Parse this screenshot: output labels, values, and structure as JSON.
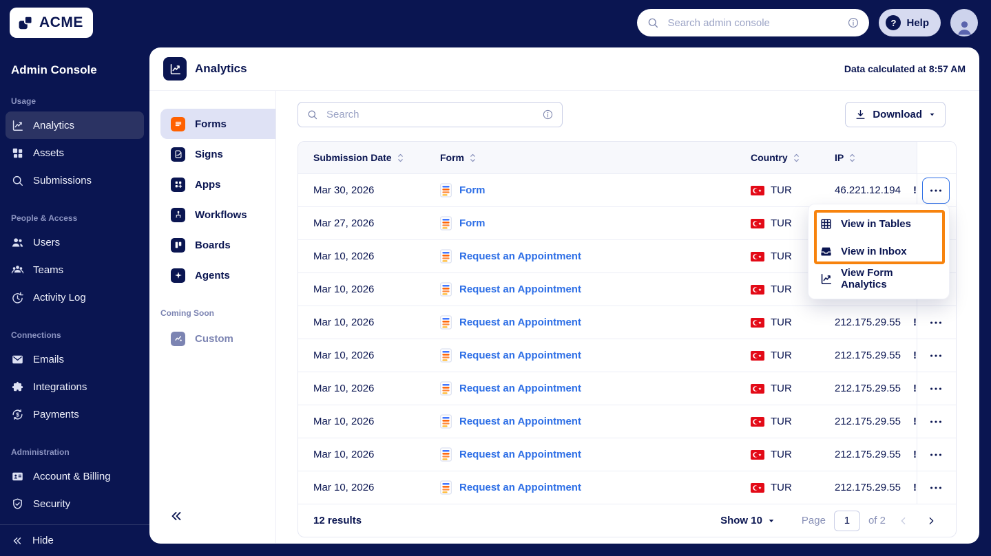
{
  "topbar": {
    "logo_text": "ACME",
    "search_placeholder": "Search admin console",
    "help_label": "Help",
    "help_glyph": "?"
  },
  "sidebar": {
    "title": "Admin Console",
    "sections": [
      {
        "label": "Usage",
        "items": [
          {
            "label": "Analytics",
            "icon": "analytics",
            "active": true
          },
          {
            "label": "Assets",
            "icon": "assets"
          },
          {
            "label": "Submissions",
            "icon": "search"
          }
        ]
      },
      {
        "label": "People & Access",
        "items": [
          {
            "label": "Users",
            "icon": "users"
          },
          {
            "label": "Teams",
            "icon": "teams"
          },
          {
            "label": "Activity Log",
            "icon": "activity"
          }
        ]
      },
      {
        "label": "Connections",
        "items": [
          {
            "label": "Emails",
            "icon": "mail"
          },
          {
            "label": "Integrations",
            "icon": "puzzle"
          },
          {
            "label": "Payments",
            "icon": "payments"
          }
        ]
      },
      {
        "label": "Administration",
        "items": [
          {
            "label": "Account & Billing",
            "icon": "card"
          },
          {
            "label": "Security",
            "icon": "shield"
          }
        ]
      }
    ],
    "hide_label": "Hide"
  },
  "card": {
    "title": "Analytics",
    "calculated": "Data calculated at 8:57 AM"
  },
  "subnav": {
    "items": [
      {
        "label": "Forms",
        "icon": "forms",
        "tile": "orange",
        "active": true
      },
      {
        "label": "Signs",
        "icon": "signs",
        "tile": "navy"
      },
      {
        "label": "Apps",
        "icon": "apps",
        "tile": "navy"
      },
      {
        "label": "Workflows",
        "icon": "workflows",
        "tile": "navy"
      },
      {
        "label": "Boards",
        "icon": "boards",
        "tile": "navy"
      },
      {
        "label": "Agents",
        "icon": "agents",
        "tile": "navy"
      }
    ],
    "coming_soon_label": "Coming Soon",
    "coming_soon_items": [
      {
        "label": "Custom",
        "icon": "custom",
        "tile": "slate"
      }
    ]
  },
  "toolbar": {
    "search_placeholder": "Search",
    "download_label": "Download"
  },
  "table": {
    "columns": [
      "Submission Date",
      "Form",
      "Country",
      "IP"
    ],
    "rows": [
      {
        "date": "Mar 30, 2026",
        "form": "Form",
        "country": "TUR",
        "ip": "46.221.12.194",
        "clip": "!",
        "menu_open": true
      },
      {
        "date": "Mar 27, 2026",
        "form": "Form",
        "country": "TUR",
        "ip": "",
        "clip": ""
      },
      {
        "date": "Mar 10, 2026",
        "form": "Request an Appointment",
        "country": "TUR",
        "ip": "",
        "clip": ""
      },
      {
        "date": "Mar 10, 2026",
        "form": "Request an Appointment",
        "country": "TUR",
        "ip": "",
        "clip": ""
      },
      {
        "date": "Mar 10, 2026",
        "form": "Request an Appointment",
        "country": "TUR",
        "ip": "212.175.29.55",
        "clip": "!"
      },
      {
        "date": "Mar 10, 2026",
        "form": "Request an Appointment",
        "country": "TUR",
        "ip": "212.175.29.55",
        "clip": "!"
      },
      {
        "date": "Mar 10, 2026",
        "form": "Request an Appointment",
        "country": "TUR",
        "ip": "212.175.29.55",
        "clip": "!"
      },
      {
        "date": "Mar 10, 2026",
        "form": "Request an Appointment",
        "country": "TUR",
        "ip": "212.175.29.55",
        "clip": "!"
      },
      {
        "date": "Mar 10, 2026",
        "form": "Request an Appointment",
        "country": "TUR",
        "ip": "212.175.29.55",
        "clip": "!"
      },
      {
        "date": "Mar 10, 2026",
        "form": "Request an Appointment",
        "country": "TUR",
        "ip": "212.175.29.55",
        "clip": "!"
      }
    ]
  },
  "menu": {
    "items": [
      {
        "label": "View in Tables",
        "icon": "grid"
      },
      {
        "label": "View in Inbox",
        "icon": "inbox"
      },
      {
        "label": "View Form Analytics",
        "icon": "chart"
      }
    ]
  },
  "pagination": {
    "results": "12 results",
    "show_label": "Show 10",
    "page_label": "Page",
    "page_value": "1",
    "of_label": "of 2"
  },
  "colors": {
    "navy": "#0A1551",
    "forms_orange": "#FF6100",
    "annotation_orange": "#F7830D",
    "link_blue": "#2E6FE6",
    "flag_red": "#E30A17"
  }
}
